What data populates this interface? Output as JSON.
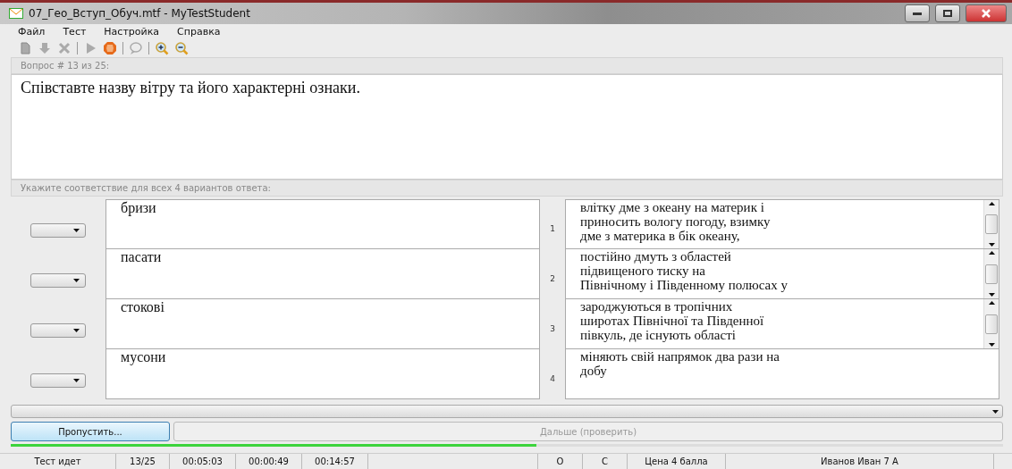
{
  "window": {
    "title": "07_Гео_Вступ_Обуч.mtf - MyTestStudent"
  },
  "menu": [
    "Файл",
    "Тест",
    "Настройка",
    "Справка"
  ],
  "toolbar": [
    {
      "kind": "page",
      "disabled": true
    },
    {
      "kind": "down",
      "disabled": true
    },
    {
      "kind": "cross",
      "disabled": true
    },
    {
      "kind": "sep"
    },
    {
      "kind": "play",
      "disabled": true
    },
    {
      "kind": "stop",
      "disabled": false
    },
    {
      "kind": "sep"
    },
    {
      "kind": "chat",
      "disabled": true
    },
    {
      "kind": "sep"
    },
    {
      "kind": "zoom-in",
      "disabled": false
    },
    {
      "kind": "zoom-out",
      "disabled": false
    }
  ],
  "question": {
    "label": "Вопрос # 13 из 25:",
    "text": "Співставте назву вітру та його характерні ознаки."
  },
  "hint": "Укажите соответствие для всех 4 вариантов ответа:",
  "left_items": [
    "бризи",
    "пасати",
    "стокові",
    "мусони"
  ],
  "right_items": [
    {
      "number": "1",
      "lines": [
        "влітку дме з океану на материк і",
        "приносить вологу погоду, взимку",
        "дме з материка в бік океану,"
      ],
      "scrollable": true
    },
    {
      "number": "2",
      "lines": [
        "постійно дмуть з областей",
        "підвищеного тиску на",
        "Північному і Південному полюсах у"
      ],
      "scrollable": true
    },
    {
      "number": "3",
      "lines": [
        "зароджуються в тропічних",
        "широтах Північної та Південної",
        "півкуль, де існують області"
      ],
      "scrollable": true
    },
    {
      "number": "4",
      "lines": [
        "міняють свій напрямок два рази на",
        "добу"
      ],
      "scrollable": false
    }
  ],
  "buttons": {
    "skip": "Пропустить...",
    "next": {
      "label": "Дальше (проверить)",
      "disabled": true
    }
  },
  "progress": {
    "level": 0.53
  },
  "status_bar": [
    "Тест идет",
    "13/25",
    "00:05:03",
    "00:00:49",
    "00:14:57",
    "О",
    "С",
    "Цена 4 балла",
    "Иванов Иван 7 А"
  ]
}
